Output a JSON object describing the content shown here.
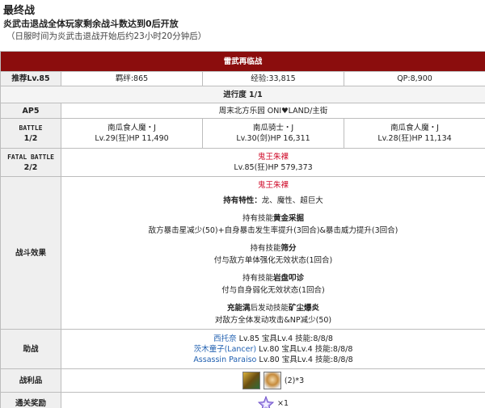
{
  "title": "最终战",
  "condition": "炎武击退战全体玩家剩余战斗数达到0后开放",
  "note": "（日服时间为炎武击退战开始后约23小时20分钟后）",
  "quest": {
    "name": "雷武再临战",
    "recommend": "推荐Lv.85",
    "bond": "羁绊:865",
    "exp": "经验:33,815",
    "qp": "QP:8,900",
    "progress": "进行度 1/1",
    "ap_label": "AP5",
    "location": "周末北方乐园 ONI♥LAND/主街",
    "battle_label_1": "BATTLE",
    "battle_label_2": "1/2",
    "enemies": [
      {
        "name": "南瓜食人魔・J",
        "stats": "Lv.29(狂)HP 11,490"
      },
      {
        "name": "南瓜骑士・J",
        "stats": "Lv.30(剑)HP 16,311"
      },
      {
        "name": "南瓜食人魔・J",
        "stats": "Lv.28(狂)HP 11,134"
      }
    ],
    "fatal_label_1": "FATAL BATTLE",
    "fatal_label_2": "2/2",
    "boss": {
      "name": "鬼王朱裸",
      "stats": "Lv.85(狂)HP 579,373"
    },
    "effect_label": "战斗效果",
    "effects": {
      "boss_name": "鬼王朱裸",
      "traits_prefix": "持有特性：",
      "traits": "龙、魔性、超巨大",
      "skill1_prefix": "持有技能",
      "skill1_name": "黄金采掘",
      "skill1_desc": "敌方暴击星减少(50)+自身暴击发生率提升(3回合)&暴击威力提升(3回合)",
      "skill2_prefix": "持有技能",
      "skill2_name": "筛分",
      "skill2_desc": "付与敌方单体强化无效状态(1回合)",
      "skill3_prefix": "持有技能",
      "skill3_name": "岩盘叩诊",
      "skill3_desc": "付与自身弱化无效状态(1回合)",
      "np_prefix": "充能满",
      "np_mid": "后发动技能",
      "np_name": "矿尘爆炎",
      "np_desc": "对敌方全体发动攻击&NP减少(50)"
    },
    "support_label": "助战",
    "supports": [
      {
        "name": "西托奈",
        "detail": " Lv.85 宝具Lv.4 技能:8/8/8"
      },
      {
        "name": "茨木童子(Lancer)",
        "detail": " Lv.80 宝具Lv.4 技能:8/8/8"
      },
      {
        "name": "Assassin Paraiso",
        "detail": " Lv.80 宝具Lv.4 技能:8/8/8"
      }
    ],
    "drops_label": "战利品",
    "drops_count": "(2)*3",
    "reward_label": "通关奖励",
    "reward_count": "×1"
  }
}
